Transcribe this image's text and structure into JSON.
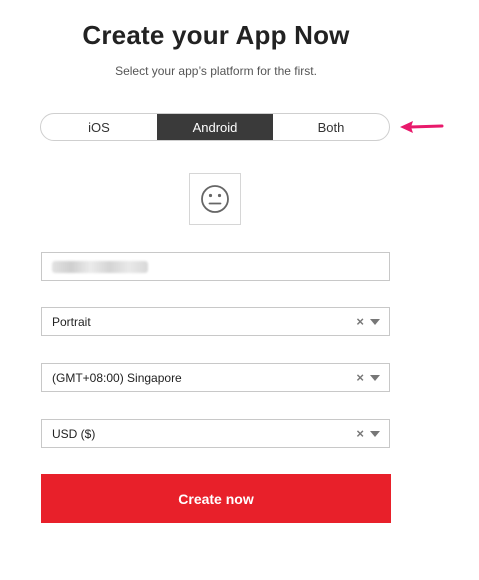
{
  "header": {
    "title": "Create your App Now",
    "subtitle": "Select your app’s platform for the first."
  },
  "platform": {
    "options": [
      "iOS",
      "Android",
      "Both"
    ],
    "selected": "Android"
  },
  "app_icon": {
    "icon": "neutral-face-icon"
  },
  "form": {
    "app_name": {
      "value": "",
      "obscured": true
    },
    "orientation": {
      "value": "Portrait"
    },
    "timezone": {
      "value": "(GMT+08:00) Singapore"
    },
    "currency": {
      "value": "USD ($)"
    },
    "clear_glyph": "×"
  },
  "submit": {
    "label": "Create now"
  },
  "colors": {
    "accent_red": "#e8202a",
    "segment_active": "#3a3a3a",
    "annotation_arrow": "#e8196b"
  }
}
